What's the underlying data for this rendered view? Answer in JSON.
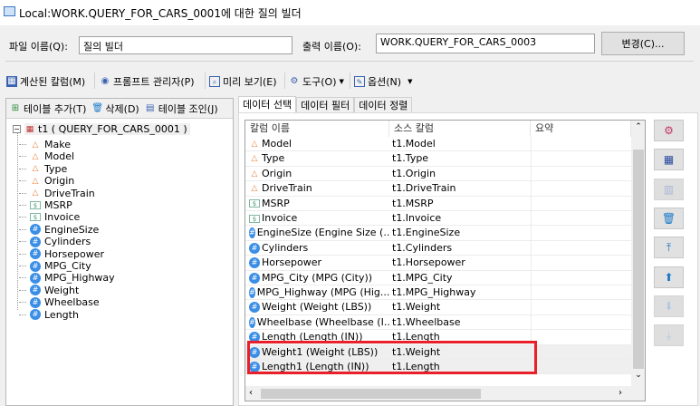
{
  "window": {
    "title": "Local:WORK.QUERY_FOR_CARS_0001에 대한 질의 빌더",
    "icon": "query-builder-icon"
  },
  "form": {
    "file_label": "파일 이름(Q):",
    "file_value": "질의 빌더",
    "output_label": "출력 이름(O):",
    "output_value": "WORK.QUERY_FOR_CARS_0003",
    "change_button": "변경(C)..."
  },
  "toolbar": [
    {
      "label": "계산된 칼럼(M)",
      "icon": "calculator-icon"
    },
    {
      "label": "프롬프트 관리자(P)",
      "icon": "prompt-icon"
    },
    {
      "label": "미리 보기(E)",
      "icon": "preview-icon"
    },
    {
      "label": "도구(O)",
      "icon": "tools-icon",
      "dropdown": true
    },
    {
      "label": "옵션(N)",
      "icon": "options-icon",
      "dropdown": true
    }
  ],
  "left_toolbar": [
    {
      "label": "테이블 추가(T)",
      "icon": "add-table-icon"
    },
    {
      "label": "삭제(D)",
      "icon": "trash-icon"
    },
    {
      "label": "테이블 조인(J)",
      "icon": "join-icon"
    }
  ],
  "tree": {
    "root": "t1 ( QUERY_FOR_CARS_0001 )",
    "items": [
      {
        "name": "Make",
        "type": "char"
      },
      {
        "name": "Model",
        "type": "char"
      },
      {
        "name": "Type",
        "type": "char"
      },
      {
        "name": "Origin",
        "type": "char"
      },
      {
        "name": "DriveTrain",
        "type": "char"
      },
      {
        "name": "MSRP",
        "type": "money"
      },
      {
        "name": "Invoice",
        "type": "money"
      },
      {
        "name": "EngineSize",
        "type": "num"
      },
      {
        "name": "Cylinders",
        "type": "num"
      },
      {
        "name": "Horsepower",
        "type": "num"
      },
      {
        "name": "MPG_City",
        "type": "num"
      },
      {
        "name": "MPG_Highway",
        "type": "num"
      },
      {
        "name": "Weight",
        "type": "num"
      },
      {
        "name": "Wheelbase",
        "type": "num"
      },
      {
        "name": "Length",
        "type": "num"
      }
    ]
  },
  "tabs": [
    {
      "label": "데이터 선택",
      "active": true
    },
    {
      "label": "데이터 필터"
    },
    {
      "label": "데이터 정렬"
    }
  ],
  "grid": {
    "columns": [
      "칼럼 이름",
      "소스 칼럼",
      "요약"
    ],
    "rows": [
      {
        "name": "Model",
        "source": "t1.Model",
        "type": "char"
      },
      {
        "name": "Type",
        "source": "t1.Type",
        "type": "char"
      },
      {
        "name": "Origin",
        "source": "t1.Origin",
        "type": "char"
      },
      {
        "name": "DriveTrain",
        "source": "t1.DriveTrain",
        "type": "char"
      },
      {
        "name": "MSRP",
        "source": "t1.MSRP",
        "type": "money"
      },
      {
        "name": "Invoice",
        "source": "t1.Invoice",
        "type": "money"
      },
      {
        "name": "EngineSize (Engine Size (...",
        "source": "t1.EngineSize",
        "type": "num"
      },
      {
        "name": "Cylinders",
        "source": "t1.Cylinders",
        "type": "num"
      },
      {
        "name": "Horsepower",
        "source": "t1.Horsepower",
        "type": "num"
      },
      {
        "name": "MPG_City (MPG (City))",
        "source": "t1.MPG_City",
        "type": "num"
      },
      {
        "name": "MPG_Highway (MPG (Hig...",
        "source": "t1.MPG_Highway",
        "type": "num"
      },
      {
        "name": "Weight (Weight (LBS))",
        "source": "t1.Weight",
        "type": "num"
      },
      {
        "name": "Wheelbase (Wheelbase (I...",
        "source": "t1.Wheelbase",
        "type": "num"
      },
      {
        "name": "Length (Length (IN))",
        "source": "t1.Length",
        "type": "num"
      },
      {
        "name": "Weight1 (Weight (LBS))",
        "source": "t1.Weight",
        "type": "num",
        "selected": true
      },
      {
        "name": "Length1 (Length (IN))",
        "source": "t1.Length",
        "type": "num",
        "selected": true
      }
    ]
  },
  "side_buttons": [
    {
      "icon": "properties-icon",
      "enabled": true
    },
    {
      "icon": "calculator-icon",
      "enabled": true
    },
    {
      "icon": "edit-column-icon",
      "enabled": false
    },
    {
      "icon": "trash-icon",
      "enabled": true
    },
    {
      "icon": "move-top-icon",
      "enabled": true
    },
    {
      "icon": "move-up-icon",
      "enabled": true
    },
    {
      "icon": "move-down-icon",
      "enabled": false
    },
    {
      "icon": "move-bottom-icon",
      "enabled": false
    }
  ],
  "highlight_color": "#e8202a"
}
